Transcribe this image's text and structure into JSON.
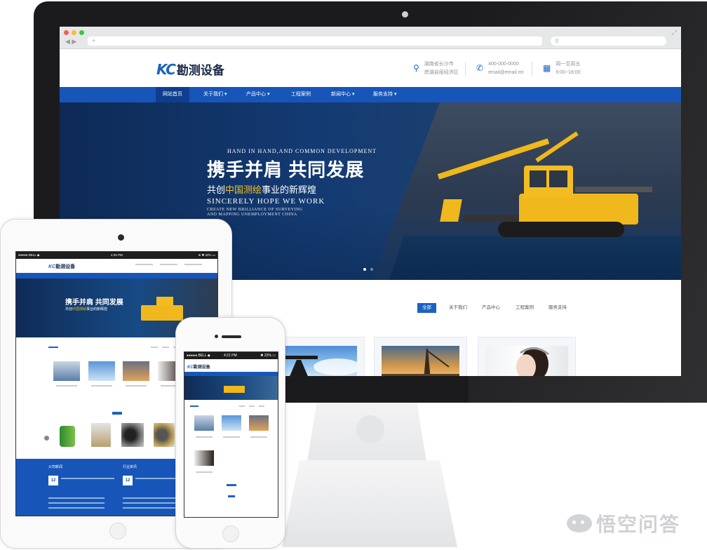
{
  "desktop": {
    "browser": {
      "address": "",
      "nav_arrows": "◀ ▶",
      "new_tab": "+",
      "search_icon": "⚲",
      "fullscreen_icon": "⤢"
    },
    "logo": {
      "mark": "KC",
      "name": "勘测设备"
    },
    "header_info": [
      {
        "icon": "location-icon",
        "line1": "湖南省长沙市",
        "line2": "岸湖自屈经济区"
      },
      {
        "icon": "phone-icon",
        "line1": "400-000-0000",
        "line2": "email@email.mt"
      },
      {
        "icon": "calendar-icon",
        "line1": "周一至周五",
        "line2": "9:00~18:00"
      }
    ],
    "nav": [
      {
        "label": "网站首页",
        "active": true
      },
      {
        "label": "关于我们 ▾"
      },
      {
        "label": "产品中心 ▾"
      },
      {
        "label": "工程案例"
      },
      {
        "label": "新闻中心 ▾"
      },
      {
        "label": "服务支持 ▾"
      }
    ],
    "banner": {
      "en_top": "HAND IN HAND,AND COMMON DEVELOPMENT",
      "title": "携手并肩 共同发展",
      "sub_pre": "共创",
      "sub_highlight": "中国测绘",
      "sub_post": "事业的新辉煌",
      "en_mid": "SINCERELY HOPE WE WORK",
      "en_small": "CREATE NEW BRILLIANCE OF SURVEYING AND MAPPING UNEMPLOYMENT CHINA"
    },
    "filter_tabs": [
      {
        "label": "全部",
        "active": true
      },
      {
        "label": "关于我们"
      },
      {
        "label": "产品中心"
      },
      {
        "label": "工程案例"
      },
      {
        "label": "服务支持"
      }
    ]
  },
  "tablet": {
    "status_left": "●●●●● BELL ◆",
    "status_time": "4:25 PM",
    "status_right": "⊛ ✱ 22% ▭",
    "logo_mark": "KC",
    "logo_name": "勘测设备",
    "banner_title": "携手并肩 共同发展",
    "banner_sub_pre": "共创",
    "banner_sub_highlight": "中国测绘",
    "banner_sub_post": "事业的新辉煌",
    "footer_left_label": "公司新闻",
    "footer_right_label": "行业资讯",
    "date_left": "12",
    "date_right": "12"
  },
  "phone": {
    "status_left": "●●●●● BELL ◆",
    "status_time": "4:21 PM",
    "status_right": "✱ 22% ▭",
    "logo_mark": "KC",
    "logo_name": "勘测设备"
  },
  "watermark": {
    "text": "悟空问答"
  }
}
